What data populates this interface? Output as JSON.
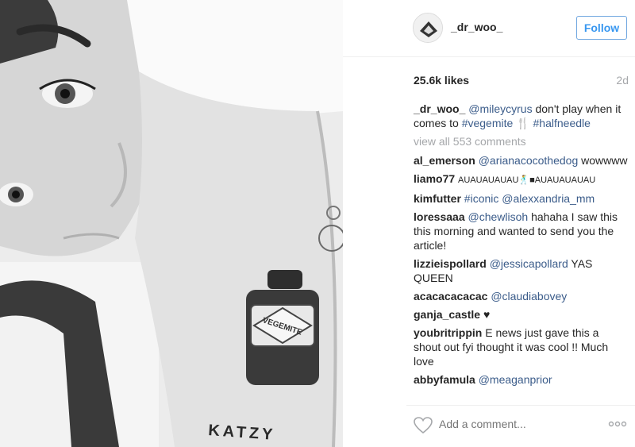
{
  "post": {
    "username": "_dr_woo_",
    "follow_label": "Follow",
    "likes": "25.6k likes",
    "time": "2d",
    "caption": {
      "user": "_dr_woo_",
      "mention": "@mileycyrus",
      "text": "don't play when it comes to",
      "tag1": "#vegemite",
      "emoji": "🍴",
      "tag2": "#halfneedle"
    },
    "view_all": "view all 553 comments",
    "comments": [
      {
        "user": "al_emerson",
        "mention": "@arianacocothedog",
        "text": "wowwww"
      },
      {
        "user": "liamo77",
        "text": "AUAUAUAUAU🕺■AUAUAUAUAU"
      },
      {
        "user": "kimfutter",
        "tag": "#iconic",
        "mention": "@alexxandria_mm"
      },
      {
        "user": "loressaaa",
        "mention": "@chewlisoh",
        "text": "hahaha I saw this this morning and wanted to send you the article!"
      },
      {
        "user": "lizzieispollard",
        "mention": "@jessicapollard",
        "text": "YAS QUEEN"
      },
      {
        "user": "acacacacacac",
        "mention": "@claudiabovey"
      },
      {
        "user": "ganja_castle",
        "text": "♥"
      },
      {
        "user": "youbritrippin",
        "text": "E news just gave this a shout out fyi thought it was cool !! Much love"
      },
      {
        "user": "abbyfamula",
        "mention": "@meaganprior"
      }
    ],
    "add_comment_placeholder": "Add a comment...",
    "photo_jar_label": "VEGEMITE",
    "photo_arm_text": "KATZY"
  },
  "icons": {
    "heart": "heart-icon",
    "more": "more-options-icon",
    "avatar": "avatar"
  },
  "colors": {
    "follow_blue": "#3897f0",
    "link": "#3b5c8a",
    "muted": "#a5a7aa"
  }
}
